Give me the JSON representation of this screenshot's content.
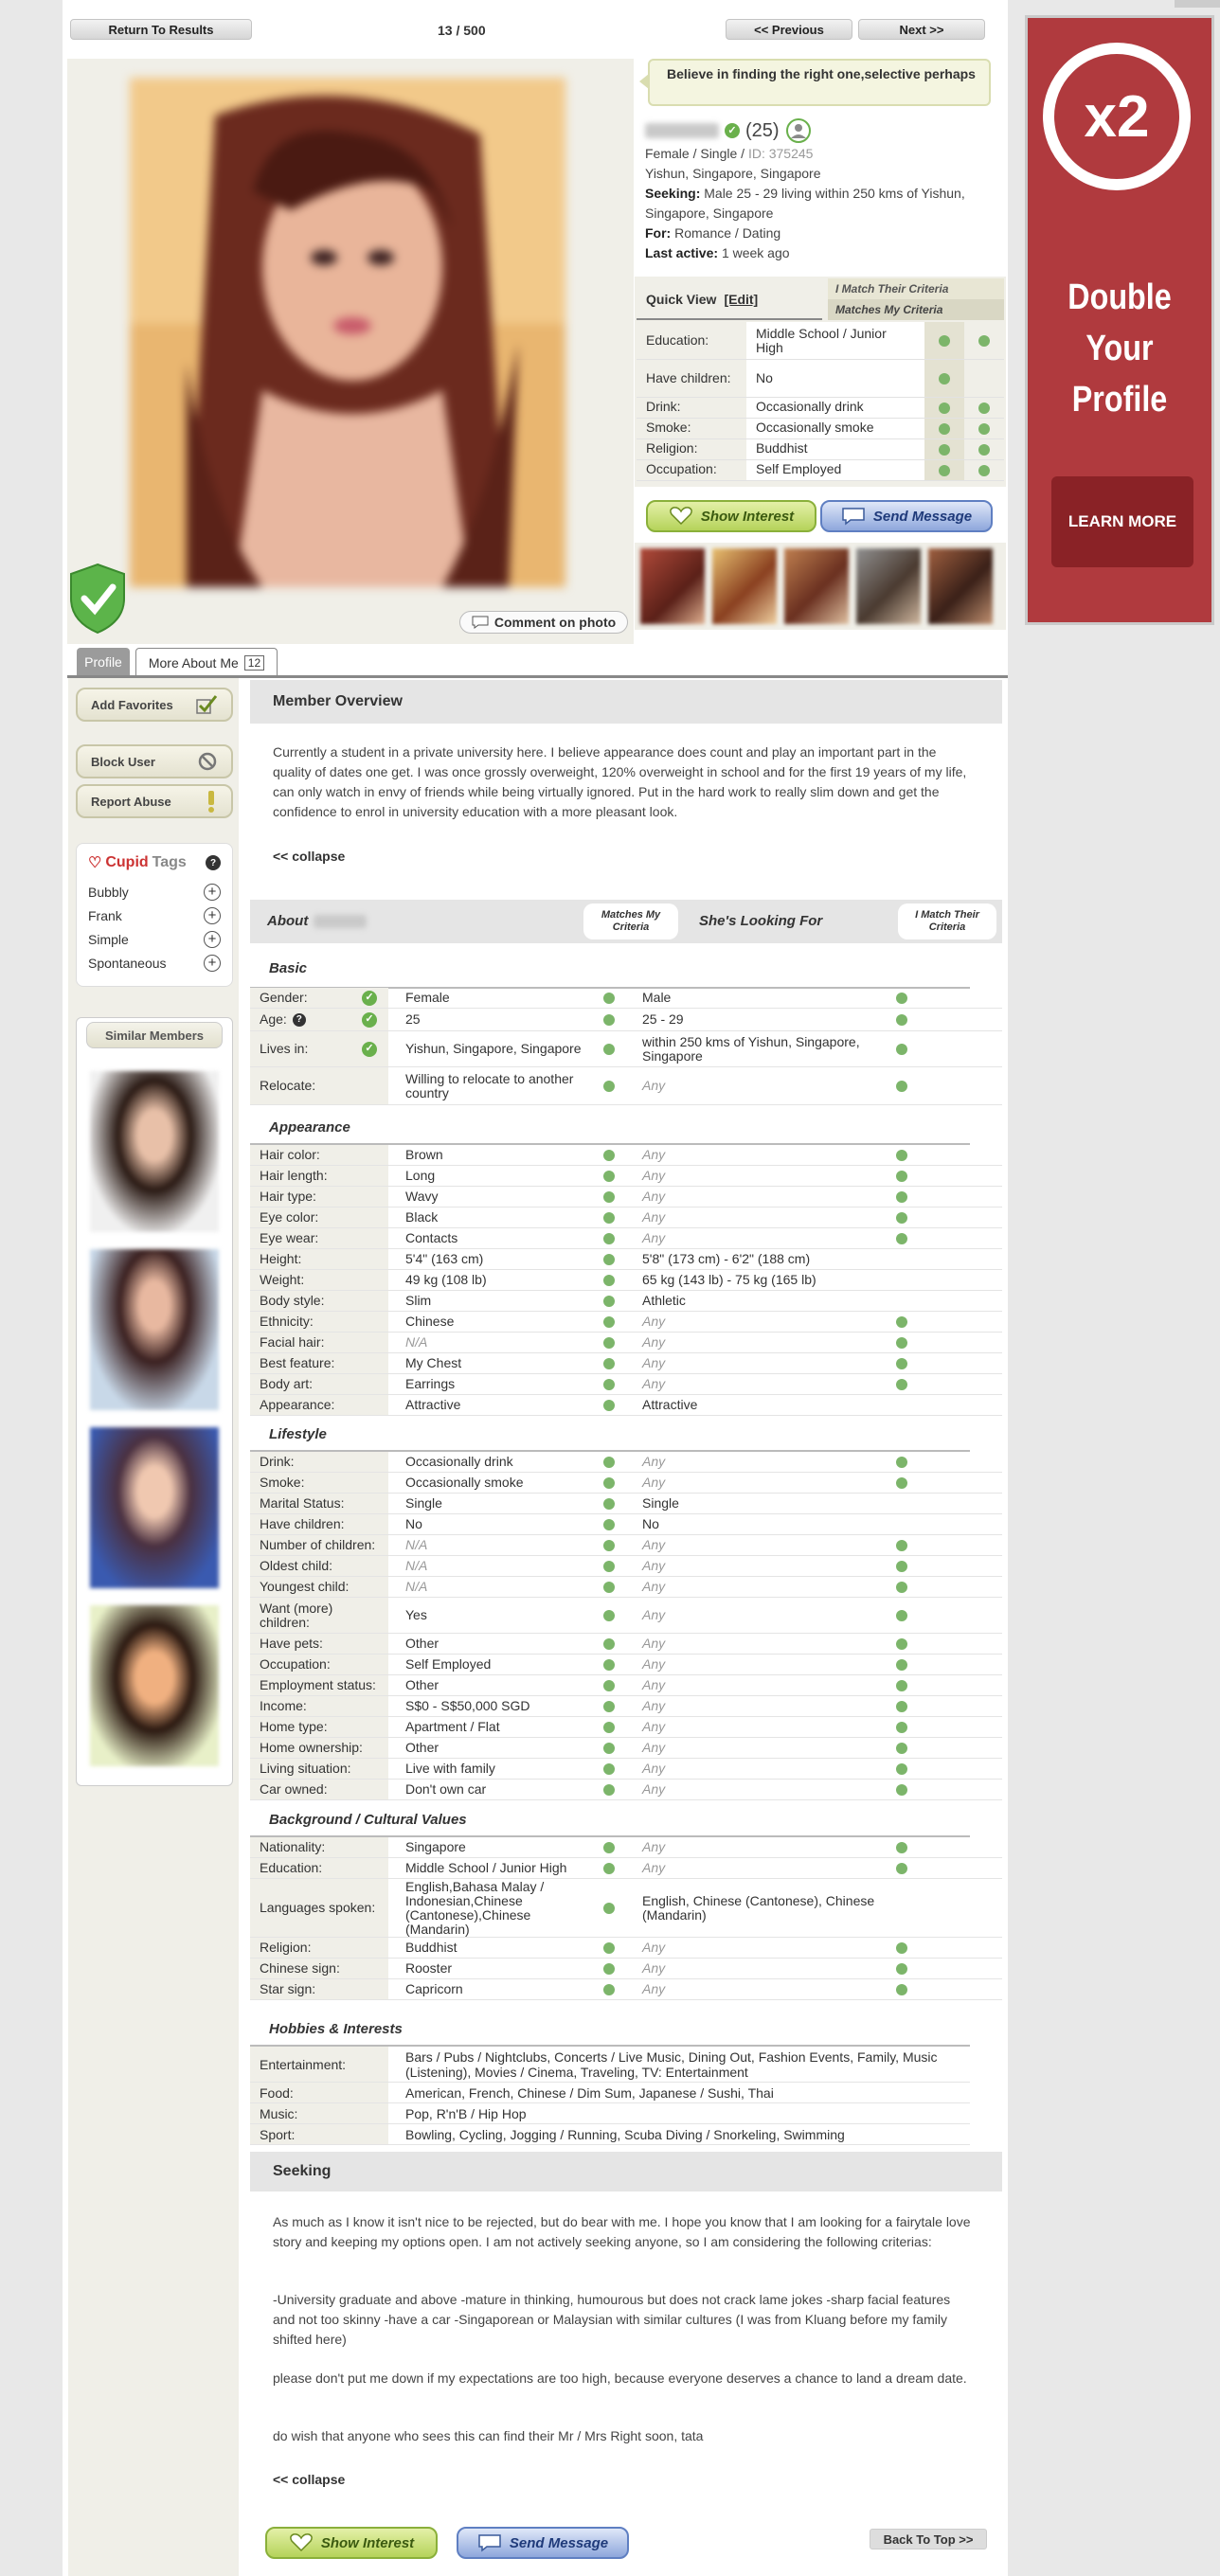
{
  "nav": {
    "back": "Return To Results",
    "counter": "13 / 500",
    "prev": "<< Previous",
    "next": "Next >>"
  },
  "profile": {
    "quote": "Believe in finding the right one,selective perhaps",
    "age": "(25)",
    "gender_status": "Female / Single /",
    "id": "ID: 375245",
    "location": "Yishun, Singapore, Singapore",
    "seeking_label": "Seeking:",
    "seeking": "Male 25 - 29 living within 250 kms of Yishun, Singapore, Singapore",
    "for_label": "For:",
    "for": "Romance / Dating",
    "active_label": "Last active:",
    "active": "1 week ago",
    "comment_photo": "Comment on photo"
  },
  "quickview": {
    "title": "Quick View",
    "edit": "[Edit]",
    "crit1": "I Match Their Criteria",
    "crit2": "Matches My Criteria",
    "rows": [
      {
        "label": "Education:",
        "value": "Middle School / Junior High"
      },
      {
        "label": "Have children:",
        "value": "No"
      },
      {
        "label": "Drink:",
        "value": "Occasionally drink"
      },
      {
        "label": "Smoke:",
        "value": "Occasionally smoke"
      },
      {
        "label": "Religion:",
        "value": "Buddhist"
      },
      {
        "label": "Occupation:",
        "value": "Self Employed"
      }
    ]
  },
  "actions": {
    "interest": "Show Interest",
    "message": "Send Message"
  },
  "tabs": {
    "profile": "Profile",
    "more": "More About Me",
    "more_count": "12"
  },
  "sidebar": {
    "add_fav": "Add Favorites",
    "block": "Block User",
    "report": "Report Abuse",
    "tags_title_a": "Cupid",
    "tags_title_b": "Tags",
    "tags": [
      "Bubbly",
      "Frank",
      "Simple",
      "Spontaneous"
    ],
    "similar": "Similar Members"
  },
  "overview": {
    "title": "Member Overview",
    "text": "Currently a student in a private university here. I believe appearance does count and play an important part in the quality of dates one get. I was once grossly overweight, 120% overweight in school and for the first 19 years of my life, can only watch in envy of friends while being virtually ignored. Put in the hard work to really slim down and get the confidence to enrol in university education with a more pleasant look.",
    "collapse": "<< collapse"
  },
  "about": {
    "about_label": "About",
    "matches_my": "Matches My Criteria",
    "looking": "She's Looking For",
    "i_match": "I Match Their Criteria"
  },
  "groups": {
    "basic": "Basic",
    "appearance": "Appearance",
    "lifestyle": "Lifestyle",
    "background": "Background / Cultural Values",
    "hobbies": "Hobbies & Interests"
  },
  "basic": [
    {
      "label": "Gender:",
      "value": "Female",
      "want": "Male"
    },
    {
      "label": "Age:",
      "value": "25",
      "want": "25 - 29"
    },
    {
      "label": "Lives in:",
      "value": "Yishun, Singapore, Singapore",
      "want": "within 250 kms of Yishun, Singapore, Singapore"
    },
    {
      "label": "Relocate:",
      "value": "Willing to relocate to another country",
      "want": "Any"
    }
  ],
  "appearance": [
    {
      "label": "Hair color:",
      "value": "Brown",
      "want": "Any"
    },
    {
      "label": "Hair length:",
      "value": "Long",
      "want": "Any"
    },
    {
      "label": "Hair type:",
      "value": "Wavy",
      "want": "Any"
    },
    {
      "label": "Eye color:",
      "value": "Black",
      "want": "Any"
    },
    {
      "label": "Eye wear:",
      "value": "Contacts",
      "want": "Any"
    },
    {
      "label": "Height:",
      "value": "5'4\" (163 cm)",
      "want": "5'8\" (173 cm) - 6'2\" (188 cm)"
    },
    {
      "label": "Weight:",
      "value": "49 kg (108 lb)",
      "want": "65 kg (143 lb) - 75 kg (165 lb)"
    },
    {
      "label": "Body style:",
      "value": "Slim",
      "want": "Athletic"
    },
    {
      "label": "Ethnicity:",
      "value": "Chinese",
      "want": "Any"
    },
    {
      "label": "Facial hair:",
      "value": "N/A",
      "want": "Any"
    },
    {
      "label": "Best feature:",
      "value": "My Chest",
      "want": "Any"
    },
    {
      "label": "Body art:",
      "value": "Earrings",
      "want": "Any"
    },
    {
      "label": "Appearance:",
      "value": "Attractive",
      "want": "Attractive"
    }
  ],
  "lifestyle": [
    {
      "label": "Drink:",
      "value": "Occasionally drink",
      "want": "Any"
    },
    {
      "label": "Smoke:",
      "value": "Occasionally smoke",
      "want": "Any"
    },
    {
      "label": "Marital Status:",
      "value": "Single",
      "want": "Single"
    },
    {
      "label": "Have children:",
      "value": "No",
      "want": "No"
    },
    {
      "label": "Number of children:",
      "value": "N/A",
      "want": "Any"
    },
    {
      "label": "Oldest child:",
      "value": "N/A",
      "want": "Any"
    },
    {
      "label": "Youngest child:",
      "value": "N/A",
      "want": "Any"
    },
    {
      "label": "Want (more) children:",
      "value": "Yes",
      "want": "Any"
    },
    {
      "label": "Have pets:",
      "value": "Other",
      "want": "Any"
    },
    {
      "label": "Occupation:",
      "value": "Self Employed",
      "want": "Any"
    },
    {
      "label": "Employment status:",
      "value": "Other",
      "want": "Any"
    },
    {
      "label": "Income:",
      "value": "S$0 - S$50,000 SGD",
      "want": "Any"
    },
    {
      "label": "Home type:",
      "value": "Apartment / Flat",
      "want": "Any"
    },
    {
      "label": "Home ownership:",
      "value": "Other",
      "want": "Any"
    },
    {
      "label": "Living situation:",
      "value": "Live with family",
      "want": "Any"
    },
    {
      "label": "Car owned:",
      "value": "Don't own car",
      "want": "Any"
    }
  ],
  "background": [
    {
      "label": "Nationality:",
      "value": "Singapore",
      "want": "Any"
    },
    {
      "label": "Education:",
      "value": "Middle School / Junior High",
      "want": "Any"
    },
    {
      "label": "Languages spoken:",
      "value": "English,Bahasa Malay / Indonesian,Chinese (Cantonese),Chinese (Mandarin)",
      "want": "English, Chinese (Cantonese), Chinese (Mandarin)"
    },
    {
      "label": "Religion:",
      "value": "Buddhist",
      "want": "Any"
    },
    {
      "label": "Chinese sign:",
      "value": "Rooster",
      "want": "Any"
    },
    {
      "label": "Star sign:",
      "value": "Capricorn",
      "want": "Any"
    }
  ],
  "hobbies": [
    {
      "label": "Entertainment:",
      "value": "Bars / Pubs / Nightclubs, Concerts / Live Music, Dining Out, Fashion Events, Family, Music (Listening), Movies / Cinema, Traveling, TV: Entertainment"
    },
    {
      "label": "Food:",
      "value": "American, French, Chinese / Dim Sum, Japanese / Sushi, Thai"
    },
    {
      "label": "Music:",
      "value": "Pop, R'n'B / Hip Hop"
    },
    {
      "label": "Sport:",
      "value": "Bowling, Cycling, Jogging / Running, Scuba Diving / Snorkeling, Swimming"
    }
  ],
  "seeking_sec": {
    "title": "Seeking",
    "p1": "As much as I know it isn't nice to be rejected, but do bear with me. I hope you know that I am looking for a fairytale love story and keeping my options open. I am not actively seeking anyone, so I am considering the following criterias:",
    "p2": "-University graduate and above -mature in thinking, humourous but does not crack lame jokes -sharp facial features and not too skinny -have a car -Singaporean or Malaysian with similar cultures (I was from Kluang before my family shifted here)",
    "p3": "please don't put me down if my expectations are too high, because everyone deserves a chance to land a dream date.",
    "p4": "do wish that anyone who sees this can find their Mr / Mrs Right soon, tata",
    "collapse": "<< collapse",
    "back_top": "Back To Top >>"
  },
  "ad": {
    "badge": "x2",
    "line1": "Double",
    "line2": "Your",
    "line3": "Profile",
    "cta": "LEARN MORE",
    "color": "#b03a3e"
  }
}
